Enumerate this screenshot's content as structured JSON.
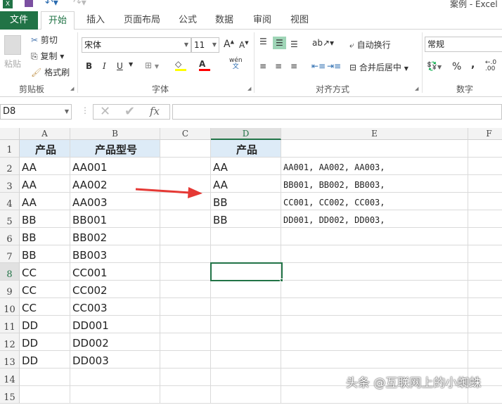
{
  "window": {
    "title": "案例 - Excel"
  },
  "tabs": [
    {
      "label": "文件"
    },
    {
      "label": "开始"
    },
    {
      "label": "插入"
    },
    {
      "label": "页面布局"
    },
    {
      "label": "公式"
    },
    {
      "label": "数据"
    },
    {
      "label": "审阅"
    },
    {
      "label": "视图"
    }
  ],
  "ribbon": {
    "clipboard": {
      "paste": "粘贴",
      "cut": "剪切",
      "copy": "复制",
      "format_painter": "格式刷",
      "label": "剪贴板"
    },
    "font": {
      "name": "宋体",
      "size": "11",
      "bold": "B",
      "italic": "I",
      "underline": "U",
      "phonetic_top": "wén",
      "phonetic_bottom": "文",
      "label": "字体",
      "fill_color": "#ffff00",
      "font_color": "#ff0000"
    },
    "alignment": {
      "wrap": "自动换行",
      "merge": "合并后居中",
      "label": "对齐方式"
    },
    "number": {
      "format": "常规",
      "percent": "%",
      "comma": ",",
      "label": "数字"
    }
  },
  "formula_bar": {
    "name_box": "D8",
    "value": ""
  },
  "columns": [
    "A",
    "B",
    "C",
    "D",
    "E",
    "F"
  ],
  "rows": [
    "1",
    "2",
    "3",
    "4",
    "5",
    "6",
    "7",
    "8",
    "9",
    "10",
    "11",
    "12",
    "13",
    "14",
    "15"
  ],
  "cells": {
    "A": [
      "产品",
      "AA",
      "AA",
      "AA",
      "BB",
      "BB",
      "BB",
      "CC",
      "CC",
      "CC",
      "DD",
      "DD",
      "DD"
    ],
    "B": [
      "产品型号",
      "AA001",
      "AA002",
      "AA003",
      "BB001",
      "BB002",
      "BB003",
      "CC001",
      "CC002",
      "CC003",
      "DD001",
      "DD002",
      "DD003"
    ],
    "D": [
      "产品",
      "AA",
      "AA",
      "BB",
      "BB"
    ],
    "E": [
      "",
      "AA001, AA002, AA003,",
      "BB001, BB002, BB003,",
      "CC001, CC002, CC003,",
      "DD001, DD002, DD003,"
    ]
  },
  "selected_cell": "D8",
  "watermark": "头条 @互联网上的小蜘蛛",
  "colors": {
    "accent": "#217346",
    "header_fill": "#ddebf7",
    "arrow": "#e53935"
  }
}
